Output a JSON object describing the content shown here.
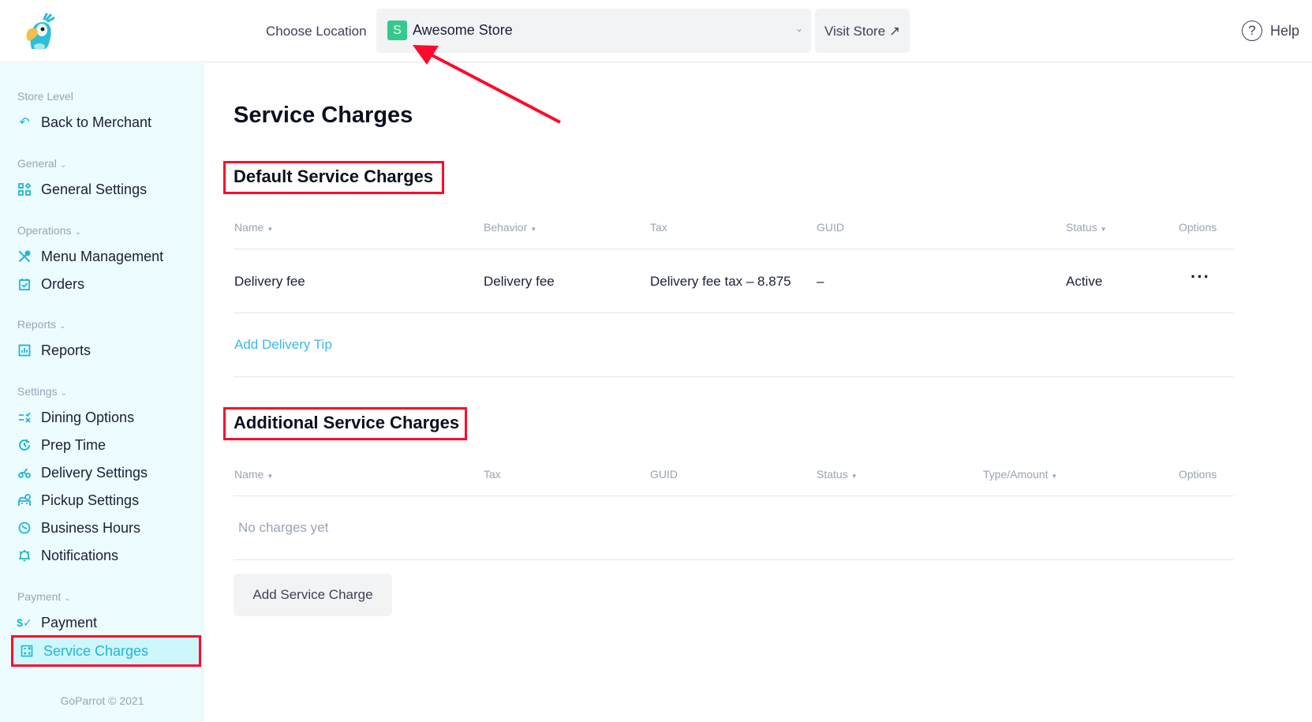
{
  "header": {
    "choose_location_label": "Choose Location",
    "location": {
      "badge": "S",
      "name": "Awesome Store",
      "badge_color": "#34c98e"
    },
    "visit_store_label": "Visit Store ↗",
    "help_label": "Help"
  },
  "sidebar": {
    "store_level_label": "Store Level",
    "back_label": "Back to Merchant",
    "sections": [
      {
        "label": "General",
        "items": [
          {
            "label": "General Settings",
            "icon": "grid-icon"
          }
        ]
      },
      {
        "label": "Operations",
        "items": [
          {
            "label": "Menu Management",
            "icon": "utensils-icon"
          },
          {
            "label": "Orders",
            "icon": "clipboard-check-icon"
          }
        ]
      },
      {
        "label": "Reports",
        "items": [
          {
            "label": "Reports",
            "icon": "bar-chart-icon"
          }
        ]
      },
      {
        "label": "Settings",
        "items": [
          {
            "label": "Dining Options",
            "icon": "list-check-icon"
          },
          {
            "label": "Prep Time",
            "icon": "clock-refresh-icon"
          },
          {
            "label": "Delivery Settings",
            "icon": "scooter-icon"
          },
          {
            "label": "Pickup Settings",
            "icon": "car-clock-icon"
          },
          {
            "label": "Business Hours",
            "icon": "timer-icon"
          },
          {
            "label": "Notifications",
            "icon": "bell-icon"
          }
        ]
      },
      {
        "label": "Payment",
        "items": [
          {
            "label": "Payment",
            "icon": "dollar-check-icon"
          },
          {
            "label": "Service Charges",
            "icon": "calculator-icon",
            "active": true
          }
        ]
      }
    ],
    "footer": "GoParrot © 2021"
  },
  "main": {
    "title": "Service Charges",
    "default_section": {
      "title": "Default Service Charges",
      "columns": [
        "Name",
        "Behavior",
        "Tax",
        "GUID",
        "Status",
        "Options"
      ],
      "rows": [
        {
          "name": "Delivery fee",
          "behavior": "Delivery fee",
          "tax": "Delivery fee tax – 8.875",
          "guid": "–",
          "status": "Active"
        }
      ],
      "add_link": "Add Delivery Tip"
    },
    "additional_section": {
      "title": "Additional Service Charges",
      "columns": [
        "Name",
        "Tax",
        "GUID",
        "Status",
        "Type/Amount",
        "Options"
      ],
      "empty_text": "No charges yet",
      "add_button": "Add Service Charge"
    }
  },
  "annotation_color": "#ff0a2c"
}
